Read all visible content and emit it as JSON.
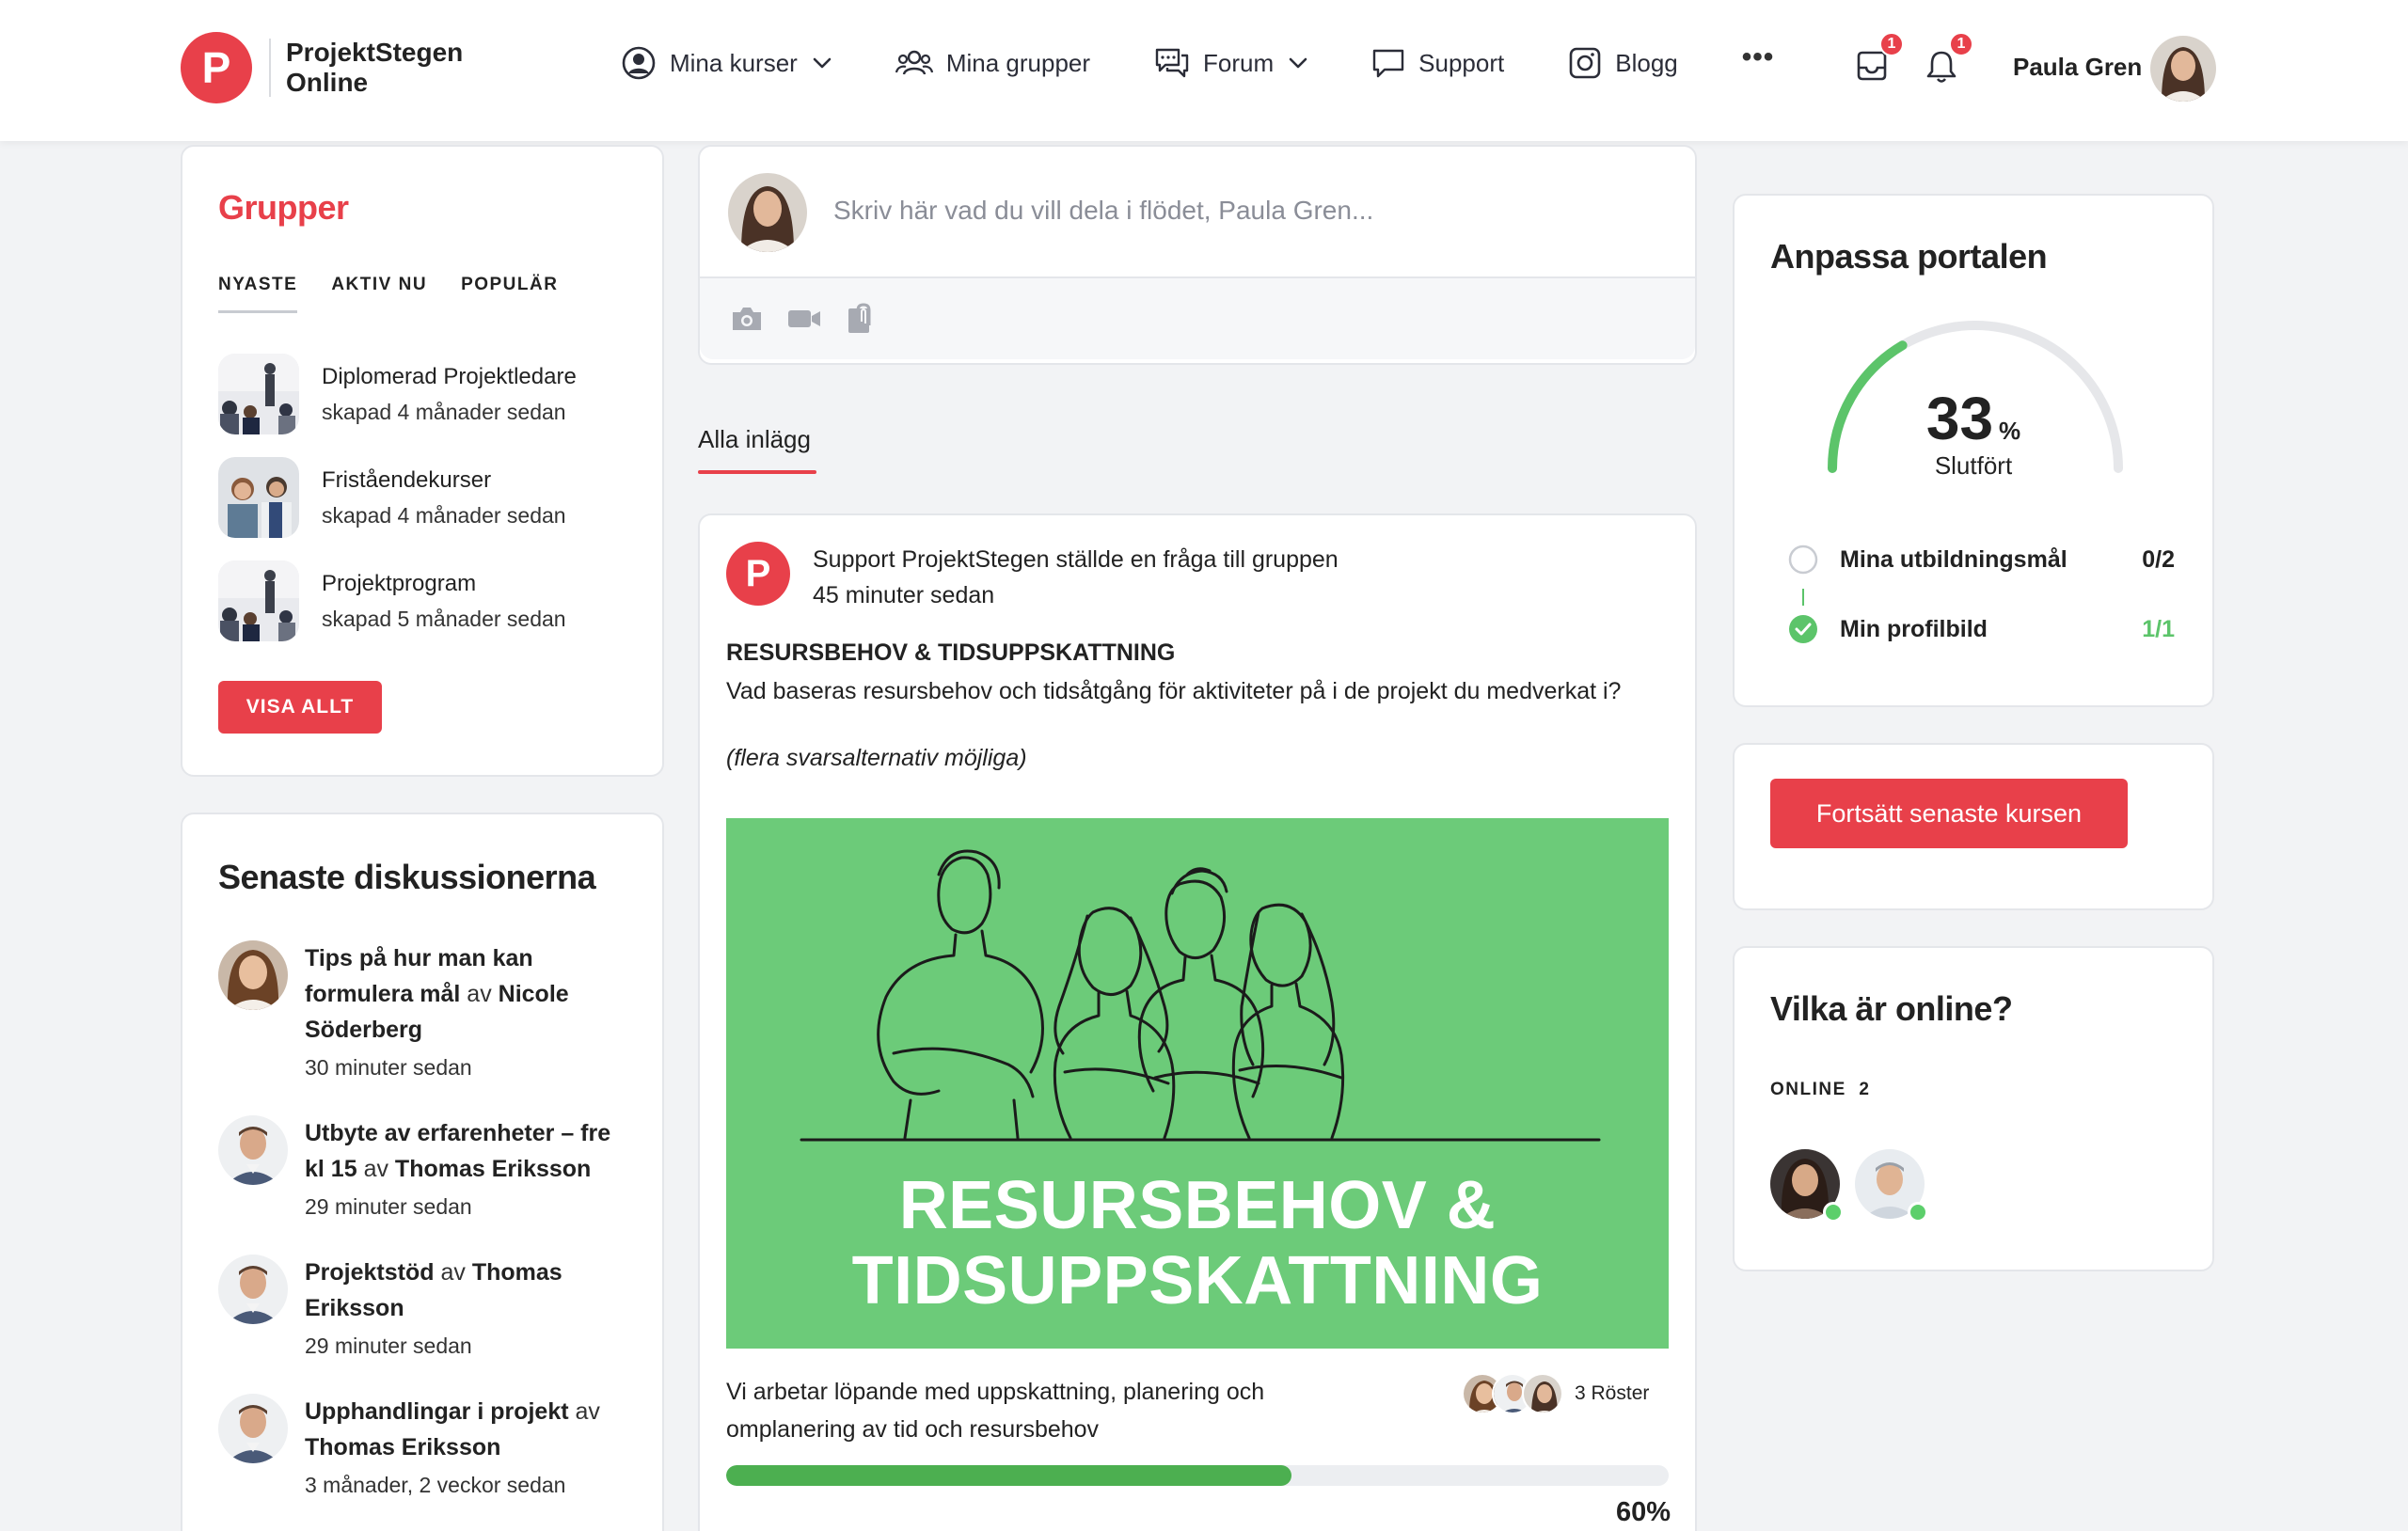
{
  "header": {
    "logo_letter": "P",
    "logo_line1": "ProjektStegen",
    "logo_line2": "Online",
    "nav": [
      {
        "label": "Mina kurser",
        "icon": "user-circle-icon"
      },
      {
        "label": "Mina grupper",
        "icon": "users-icon"
      },
      {
        "label": "Forum",
        "icon": "chat-bubbles-icon"
      },
      {
        "label": "Support",
        "icon": "chat-bubble-icon"
      },
      {
        "label": "Blogg",
        "icon": "blog-icon"
      }
    ],
    "more": "•••",
    "inbox_badge": "1",
    "notifications_badge": "1",
    "user_name": "Paula Gren"
  },
  "groups": {
    "title": "Grupper",
    "tabs": [
      "NYASTE",
      "AKTIV NU",
      "POPULÄR"
    ],
    "active_tab": "NYASTE",
    "items": [
      {
        "name": "Diplomerad Projektledare",
        "meta": "skapad 4 månader sedan"
      },
      {
        "name": "Friståendekurser",
        "meta": "skapad 4 månader sedan"
      },
      {
        "name": "Projektprogram",
        "meta": "skapad 5 månader sedan"
      }
    ],
    "show_all": "VISA ALLT"
  },
  "discussions": {
    "title": "Senaste diskussionerna",
    "by": "av",
    "items": [
      {
        "topic": "Tips på hur man kan formulera mål",
        "author": "Nicole Söderberg",
        "time": "30 minuter sedan"
      },
      {
        "topic": "Utbyte av erfarenheter – fre kl 15",
        "author": "Thomas Eriksson",
        "time": "29 minuter sedan"
      },
      {
        "topic": "Projektstöd",
        "author": "Thomas Eriksson",
        "time": "29 minuter sedan"
      },
      {
        "topic": "Upphandlingar i projekt",
        "author": "Thomas Eriksson",
        "time": "3 månader, 2 veckor sedan"
      }
    ]
  },
  "composer": {
    "placeholder": "Skriv här vad du vill dela i flödet, Paula Gren...",
    "actions": [
      "camera-icon",
      "video-icon",
      "attachment-icon"
    ]
  },
  "feed": {
    "tab": "Alla inlägg",
    "post": {
      "avatar_letter": "P",
      "author_line": "Support ProjektStegen ställde en fråga till gruppen",
      "time": "45 minuter sedan",
      "title": "RESURSBEHOV & TIDSUPPSKATTNING",
      "text": "Vad baseras resursbehov och tidsåtgång för aktiviteter på i de projekt du medverkat i?",
      "note": "(flera svarsalternativ möjliga)",
      "banner_line1": "RESURSBEHOV &",
      "banner_line2": "TIDSUPPSKATTNING",
      "banner_color": "#6ccb79",
      "poll_option": "Vi arbetar löpande med uppskattning, planering och omplanering av tid och resursbehov",
      "votes": "3 Röster",
      "percent_label": "60%",
      "percent": 60
    }
  },
  "progress": {
    "title": "Anpassa portalen",
    "value": "33",
    "unit": "%",
    "fraction": 0.33,
    "label": "Slutfört",
    "goals": [
      {
        "label": "Mina utbildningsmål",
        "value": "0/2",
        "done": false
      },
      {
        "label": "Min profilbild",
        "value": "1/1",
        "done": true
      }
    ]
  },
  "cta": {
    "label": "Fortsätt senaste kursen"
  },
  "online": {
    "title": "Vilka är online?",
    "label": "ONLINE",
    "count": "2"
  },
  "colors": {
    "accent": "#e8404a",
    "success": "#4caf50",
    "banner": "#6ccb79"
  }
}
